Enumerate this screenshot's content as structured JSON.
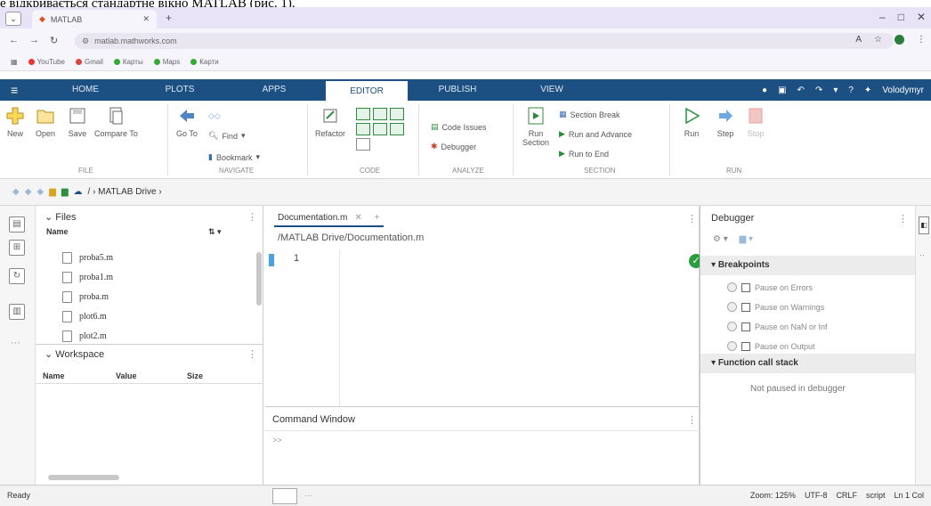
{
  "caption": "е відкривається стандартне вікно MATLAB (рис. 1).",
  "browser": {
    "tab_title": "MATLAB",
    "url": "matlab.mathworks.com",
    "window_controls": [
      "–",
      "□",
      "✕"
    ],
    "bookmarks": [
      "YouTube",
      "Gmail",
      "Карты",
      "Maps",
      "Карти"
    ]
  },
  "matlab_tabs": [
    "HOME",
    "PLOTS",
    "APPS",
    "EDITOR",
    "PUBLISH",
    "VIEW"
  ],
  "active_tab": "EDITOR",
  "user_name": "Volodymyr",
  "toolstrip": {
    "file": {
      "buttons": [
        "New",
        "Open",
        "Save",
        "Compare To"
      ],
      "label": "FILE"
    },
    "navigate": {
      "goto": "Go To",
      "find": "Find",
      "bookmark": "Bookmark",
      "label": "NAVIGATE"
    },
    "code": {
      "refactor": "Refactor",
      "label": "CODE"
    },
    "analyze": {
      "code_issues": "Code Issues",
      "debugger": "Debugger",
      "label": "ANALYZE"
    },
    "section": {
      "run_section": "Run Section",
      "section_break": "Section Break",
      "run_advance": "Run and Advance",
      "run_to_end": "Run to End",
      "label": "SECTION"
    },
    "run": {
      "run": "Run",
      "step": "Step",
      "stop": "Stop",
      "label": "RUN"
    }
  },
  "path": "/ › MATLAB Drive ›",
  "files_panel": {
    "title": "Files",
    "header": "Name",
    "files": [
      "proba5.m",
      "proba1.m",
      "proba.m",
      "plot6.m",
      "plot2.m"
    ]
  },
  "workspace": {
    "title": "Workspace",
    "columns": [
      "Name",
      "Value",
      "Size"
    ]
  },
  "editor": {
    "tab": "Documentation.m",
    "file_path": "/MATLAB Drive/Documentation.m",
    "line_number": "1"
  },
  "command_window": {
    "title": "Command Window",
    "prompt": ">>"
  },
  "debugger": {
    "title": "Debugger",
    "breakpoints_label": "Breakpoints",
    "options": [
      "Pause on Errors",
      "Pause on Warnings",
      "Pause on NaN or Inf",
      "Pause on Output"
    ],
    "call_stack_label": "Function call stack",
    "call_stack_text": "Not paused in debugger"
  },
  "status": {
    "left": "Ready",
    "zoom": "Zoom: 125%",
    "encoding": "UTF-8",
    "line_ending": "CRLF",
    "type": "script",
    "position": "Ln 1 Col"
  },
  "colors": {
    "matlab_blue": "#1c4f82",
    "browser_tab_bar": "#e9e3f7",
    "ok_green": "#2a9d3f"
  }
}
